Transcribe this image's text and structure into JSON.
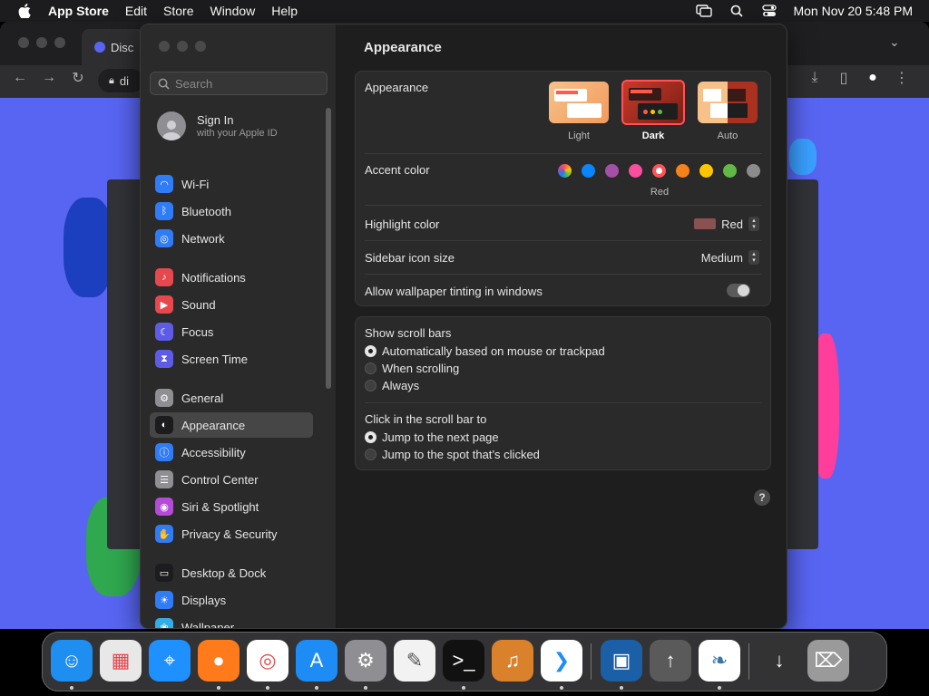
{
  "menubar": {
    "app_name": "App Store",
    "menus": [
      "Edit",
      "Store",
      "Window",
      "Help"
    ],
    "clock": "Mon Nov 20  5:48 PM"
  },
  "browser": {
    "tab_title": "Disc",
    "url_text": "di"
  },
  "settings": {
    "search_placeholder": "Search",
    "signin": {
      "title": "Sign In",
      "subtitle": "with your Apple ID"
    },
    "sidebar_items": [
      {
        "label": "Wi-Fi",
        "icon": "wifi-icon",
        "color": "#2f7cf6"
      },
      {
        "label": "Bluetooth",
        "icon": "bluetooth-icon",
        "color": "#2f7cf6"
      },
      {
        "label": "Network",
        "icon": "globe-icon",
        "color": "#2f7cf6"
      },
      {
        "label": "Notifications",
        "icon": "bell-icon",
        "color": "#e5484d"
      },
      {
        "label": "Sound",
        "icon": "speaker-icon",
        "color": "#e5484d"
      },
      {
        "label": "Focus",
        "icon": "moon-icon",
        "color": "#5e5ce6"
      },
      {
        "label": "Screen Time",
        "icon": "hourglass-icon",
        "color": "#5e5ce6"
      },
      {
        "label": "General",
        "icon": "gear-icon",
        "color": "#8e8e93"
      },
      {
        "label": "Appearance",
        "icon": "appearance-icon",
        "color": "#1c1c1e"
      },
      {
        "label": "Accessibility",
        "icon": "accessibility-icon",
        "color": "#2f7cf6"
      },
      {
        "label": "Control Center",
        "icon": "control-center-icon",
        "color": "#8e8e93"
      },
      {
        "label": "Siri & Spotlight",
        "icon": "siri-icon",
        "color": "#b44bd6"
      },
      {
        "label": "Privacy & Security",
        "icon": "hand-icon",
        "color": "#2f7cf6"
      },
      {
        "label": "Desktop & Dock",
        "icon": "dock-icon",
        "color": "#1c1c1e"
      },
      {
        "label": "Displays",
        "icon": "sun-icon",
        "color": "#2f7cf6"
      },
      {
        "label": "Wallpaper",
        "icon": "wallpaper-icon",
        "color": "#32ade6"
      }
    ],
    "page_title": "Appearance",
    "appearance": {
      "label": "Appearance",
      "options": [
        "Light",
        "Dark",
        "Auto"
      ],
      "selected": "Dark"
    },
    "accent": {
      "label": "Accent color",
      "colors": [
        "multicolor",
        "#0a84ff",
        "#a550a7",
        "#f74f9e",
        "#ff5257",
        "#f7821b",
        "#ffc600",
        "#62ba46",
        "#8c8c8c"
      ],
      "selected_name": "Red"
    },
    "highlight": {
      "label": "Highlight color",
      "value": "Red",
      "swatch": "#8a5151"
    },
    "icon_size": {
      "label": "Sidebar icon size",
      "value": "Medium"
    },
    "tinting": {
      "label": "Allow wallpaper tinting in windows",
      "enabled": false
    },
    "scroll_bars": {
      "label": "Show scroll bars",
      "options": [
        "Automatically based on mouse or trackpad",
        "When scrolling",
        "Always"
      ]
    },
    "click_scroll": {
      "label": "Click in the scroll bar to",
      "options": [
        "Jump to the next page",
        "Jump to the spot that’s clicked"
      ]
    },
    "help": "?"
  },
  "dock": {
    "apps": [
      {
        "name": "finder",
        "color": "#1e8ef0"
      },
      {
        "name": "launchpad",
        "color": "#e8e8e8"
      },
      {
        "name": "safari",
        "color": "#1e90ff"
      },
      {
        "name": "firefox",
        "color": "#ff7a1a"
      },
      {
        "name": "chrome",
        "color": "#ffffff"
      },
      {
        "name": "app-store",
        "color": "#1d8cf5"
      },
      {
        "name": "system-settings",
        "color": "#8e8e93"
      },
      {
        "name": "textedit",
        "color": "#f2f2f2"
      },
      {
        "name": "terminal",
        "color": "#111111"
      },
      {
        "name": "garageband",
        "color": "#d9822b"
      },
      {
        "name": "vscode",
        "color": "#ffffff"
      },
      {
        "name": "virtualbox",
        "color": "#1b5fa7"
      },
      {
        "name": "rocket",
        "color": "#5a5a5a"
      },
      {
        "name": "python",
        "color": "#ffffff"
      },
      {
        "name": "downloads",
        "color": "#333333"
      },
      {
        "name": "trash",
        "color": "#9a9a9a"
      }
    ]
  }
}
